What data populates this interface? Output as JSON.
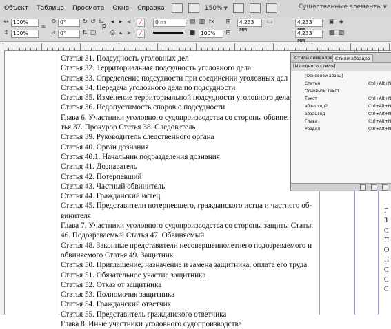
{
  "menubar": {
    "items": [
      "Объект",
      "Таблица",
      "Просмотр",
      "Окно",
      "Справка"
    ],
    "zoom": "150%",
    "workspace": "Существенные элементы"
  },
  "controlbar": {
    "scale_x": "100%",
    "scale_y": "100%",
    "rotate": "0°",
    "shear": "0°",
    "w_value": "4,233 мм",
    "h_value": "4,233 мм",
    "stroke_value": "0 пт",
    "opacity": "100%"
  },
  "document": {
    "lines": [
      "Статья 31. Подсудность уголовных дел",
      "Статья 32. Территориальная подсудность уголовного дела",
      "Статья 33. Определение подсудности при соединении уголовных дел",
      "Статья 34. Передача уголовного дела по подсудности",
      "Статья 35. Изменение территориальной подсудности уголовного дела",
      "Статья 36. Недопустимость споров о подсудности",
      "Глава 6. Участники уголовного судопроизводства со стороны обвинения Ста",
      "тья 37. Прокурор Статья 38. Следователь",
      "Статья 39. Руководитель следственного органа",
      "Статья 40. Орган дознания",
      "Статья 40.1. Начальник подразделения дознания",
      "Статья 41. Дознаватель",
      "Статья 42. Потерпевший",
      "Статья 43. Частный обвинитель",
      "Статья 44. Гражданский истец",
      "Статья 45. Представители потерпевшего, гражданского истца и частного об-",
      "винителя",
      "Глава 7. Участники уголовного судопроизводства со стороны защиты Статья",
      "46. Подозреваемый Статья 47. Обвиняемый",
      "Статья 48. Законные представители несовершеннолетнего подозреваемого и",
      "обвиняемого Статья 49. Защитник",
      "Статья 50. Приглашение, назначение и замена защитника, оплата его труда",
      "Статья 51. Обязательное участие защитника",
      "Статья 52. Отказ от защитника",
      "Статья 53. Полномочия защитника",
      "Статья 54. Гражданский ответчик",
      "Статья 55. Представитель гражданского ответчика",
      "Глава 8. Иные участники уголовного судопроизводства"
    ],
    "right_fragments": [
      "Г",
      "З",
      "С",
      "П",
      "О",
      "Н",
      "С",
      "С",
      "С"
    ]
  },
  "styles_panel": {
    "tab_char": "Стили символов",
    "tab_para": "Стили абзацев",
    "current": "[Из одного стиля]",
    "rows": [
      {
        "name": "[Основной абзац]",
        "shortcut": ""
      },
      {
        "name": "Статья",
        "shortcut": "Ctrl+Alt+Num"
      },
      {
        "name": "Основной текст",
        "shortcut": ""
      },
      {
        "name": "Текст",
        "shortcut": "Ctrl+Alt+Num"
      },
      {
        "name": "абзацсод2",
        "shortcut": "Ctrl+Alt+Num"
      },
      {
        "name": "абзацсод",
        "shortcut": "Ctrl+Alt+Num"
      },
      {
        "name": "Глава",
        "shortcut": "Ctrl+Alt+Num"
      },
      {
        "name": "Раздел",
        "shortcut": "Ctrl+Alt+Num"
      }
    ]
  }
}
